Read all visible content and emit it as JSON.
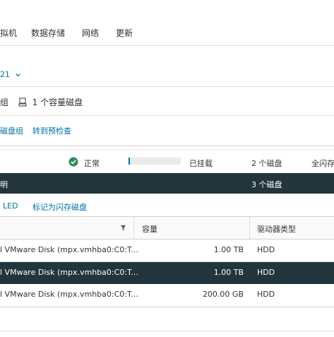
{
  "tabs": [
    {
      "label": "拟机"
    },
    {
      "label": "数据存储"
    },
    {
      "label": "网络"
    },
    {
      "label": "更新"
    }
  ],
  "selector": {
    "label": "21"
  },
  "group_summary": {
    "prefix": "组",
    "text": "1 个容量磁盘"
  },
  "actions": {
    "disk_group": "磁盘组",
    "pre_check": "转到预检查"
  },
  "status_row": {
    "status": "正常",
    "mounted": "已挂载",
    "disk_count": "2 个磁盘",
    "flash_partial": "全闪存"
  },
  "selected_header": {
    "label": "明",
    "disk_count": "3 个磁盘"
  },
  "disk_actions": {
    "led": "LED",
    "mark_flash": "标记为闪存磁盘"
  },
  "table": {
    "columns": {
      "capacity": "容量",
      "drive_type": "驱动器类型"
    },
    "rows": [
      {
        "name": "l VMware Disk (mpx.vmhba0:C0:T...",
        "capacity": "1.00 TB",
        "type": "HDD",
        "selected": false
      },
      {
        "name": "l VMware Disk (mpx.vmhba0:C0:T...",
        "capacity": "1.00 TB",
        "type": "HDD",
        "selected": true
      },
      {
        "name": "l VMware Disk (mpx.vmhba0:C0:T...",
        "capacity": "200.00 GB",
        "type": "HDD",
        "selected": false
      }
    ]
  },
  "colors": {
    "accent": "#0072a3",
    "dark_row": "#22343c",
    "status_ok": "#2e8b57"
  }
}
